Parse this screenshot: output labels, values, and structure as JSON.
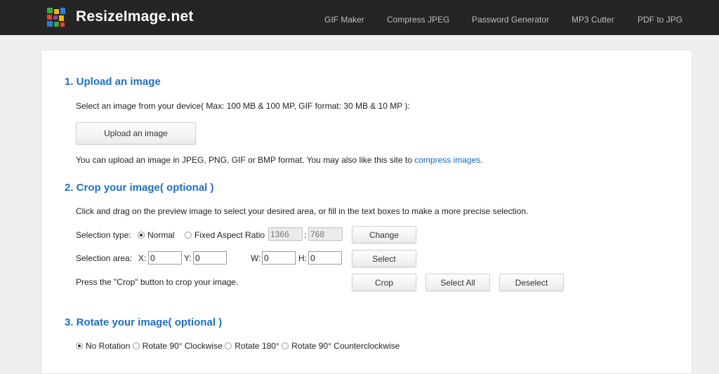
{
  "header": {
    "brand": "ResizeImage.net",
    "nav": [
      "GIF Maker",
      "Compress JPEG",
      "Password Generator",
      "MP3 Cutter",
      "PDF to JPG"
    ],
    "logo_colors": [
      "#e8412c",
      "#f5b400",
      "#3aa845",
      "#2f7be0",
      "#8e44ad"
    ]
  },
  "upload": {
    "heading": "1. Upload an image",
    "instructions": "Select an image from your device( Max: 100 MB & 100 MP, GIF format: 30 MB & 10 MP ):",
    "button": "Upload an image",
    "note_prefix": "You can upload an image in JPEG, PNG, GIF or BMP format. You may also like this site to ",
    "note_link": "compress images",
    "note_suffix": "."
  },
  "crop": {
    "heading": "2. Crop your image( optional )",
    "instructions": "Click and drag on the preview image to select your desired area, or fill in the text boxes to make a more precise selection.",
    "selection_type_label": "Selection type:",
    "option_normal": "Normal",
    "option_fixed": "Fixed Aspect Ratio",
    "ratio_w": "1366",
    "ratio_sep": ":",
    "ratio_h": "768",
    "change_button": "Change",
    "selection_area_label": "Selection area:",
    "x_label": "X:",
    "x_value": "0",
    "y_label": "Y:",
    "y_value": "0",
    "w_label": "W:",
    "w_value": "0",
    "h_label": "H:",
    "h_value": "0",
    "select_button": "Select",
    "crop_note": "Press the \"Crop\" button to crop your image.",
    "crop_button": "Crop",
    "select_all_button": "Select All",
    "deselect_button": "Deselect"
  },
  "rotate": {
    "heading": "3. Rotate your image( optional )",
    "options": [
      "No Rotation",
      "Rotate 90° Clockwise",
      "Rotate 180°",
      "Rotate 90° Counterclockwise"
    ]
  }
}
